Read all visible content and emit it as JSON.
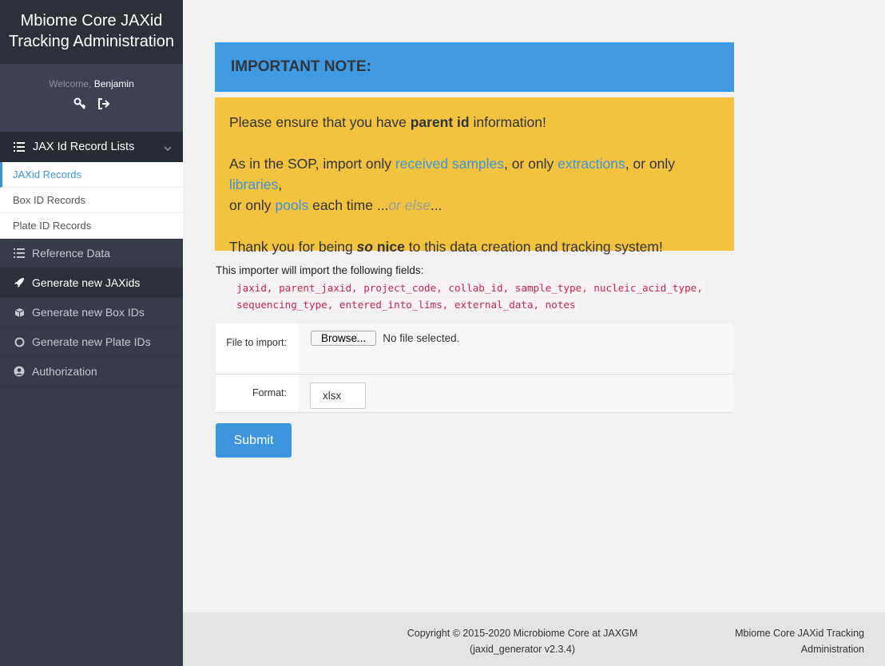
{
  "sidebar": {
    "brand": "Mbiome Core JAXid Tracking Administration",
    "welcome_label": "Welcome,",
    "username": "Benjamin",
    "section_label": "JAX Id Record Lists",
    "sub_items": [
      {
        "label": "JAXid Records",
        "active": true
      },
      {
        "label": "Box ID Records",
        "active": false
      },
      {
        "label": "Plate ID Records",
        "active": false
      }
    ],
    "items": [
      {
        "label": "Reference Data",
        "icon": "list-icon"
      },
      {
        "label": "Generate new JAXids",
        "icon": "rocket-icon"
      },
      {
        "label": "Generate new Box IDs",
        "icon": "cube-icon"
      },
      {
        "label": "Generate new Plate IDs",
        "icon": "circle-icon"
      },
      {
        "label": "Authorization",
        "icon": "user-circle-icon"
      }
    ]
  },
  "note": {
    "title": "IMPORTANT NOTE:",
    "line1_pre": "Please ensure that you have ",
    "line1_bold": "parent id",
    "line1_post": " information!",
    "line2_a": "As in the SOP, import only ",
    "link_received": "received samples",
    "line2_b": ", or only ",
    "link_extractions": "extractions",
    "line2_c": ", or only ",
    "link_libraries": "libraries",
    "line2_d": ",",
    "line2_e": "or only ",
    "link_pools": "pools",
    "line2_f": " each time ...",
    "or_else": "or else",
    "line2_g": "...",
    "line3_a": "Thank you for being ",
    "line3_so": "so",
    "line3_nice": " nice",
    "line3_b": " to this data creation and tracking system!"
  },
  "importer": {
    "intro": "This importer will import the following fields:",
    "fields_line1": "jaxid, parent_jaxid, project_code, collab_id, sample_type, nucleic_acid_type,",
    "fields_line2": "sequencing_type, entered_into_lims, external_data, notes"
  },
  "form": {
    "file_label": "File to import:",
    "browse_label": "Browse...",
    "no_file": "No file selected.",
    "format_label": "Format:",
    "format_value": "xlsx",
    "submit_label": "Submit"
  },
  "footer": {
    "copyright_line1": "Copyright © 2015-2020 Microbiome Core at JAXGM",
    "copyright_line2": "(jaxid_generator v2.3.4)",
    "brand_line1": "Mbiome Core JAXid Tracking",
    "brand_line2": "Administration"
  }
}
